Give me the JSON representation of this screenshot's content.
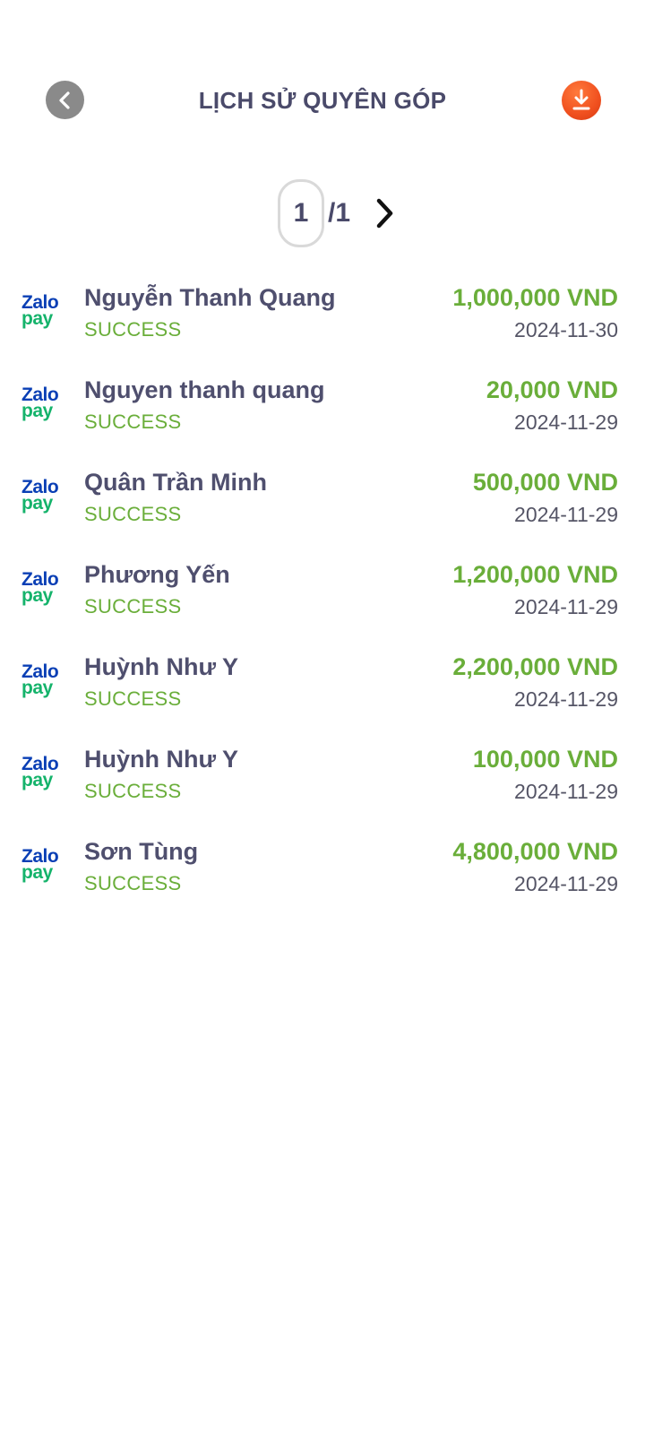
{
  "header": {
    "title": "LỊCH SỬ QUYÊN GÓP",
    "back_icon": "chevron-left-icon",
    "download_icon": "download-icon",
    "download_color": "#f0501f"
  },
  "pager": {
    "current": "1",
    "total": "/1",
    "next_icon": "chevron-right-icon"
  },
  "provider": {
    "line1": "Zalo",
    "line2": "pay",
    "color_zalo": "#0a3fb5",
    "color_pay": "#15b36b"
  },
  "donations": [
    {
      "name": "Nguyễn Thanh Quang",
      "status": "SUCCESS",
      "amount": "1,000,000 VND",
      "date": "2024-11-30"
    },
    {
      "name": "Nguyen thanh quang",
      "status": "SUCCESS",
      "amount": "20,000 VND",
      "date": "2024-11-29"
    },
    {
      "name": "Quân Trần Minh",
      "status": "SUCCESS",
      "amount": "500,000 VND",
      "date": "2024-11-29"
    },
    {
      "name": "Phương Yến",
      "status": "SUCCESS",
      "amount": "1,200,000 VND",
      "date": "2024-11-29"
    },
    {
      "name": "Huỳnh Như Y",
      "status": "SUCCESS",
      "amount": "2,200,000 VND",
      "date": "2024-11-29"
    },
    {
      "name": "Huỳnh Như Y",
      "status": "SUCCESS",
      "amount": "100,000 VND",
      "date": "2024-11-29"
    },
    {
      "name": "Sơn Tùng",
      "status": "SUCCESS",
      "amount": "4,800,000 VND",
      "date": "2024-11-29"
    }
  ]
}
